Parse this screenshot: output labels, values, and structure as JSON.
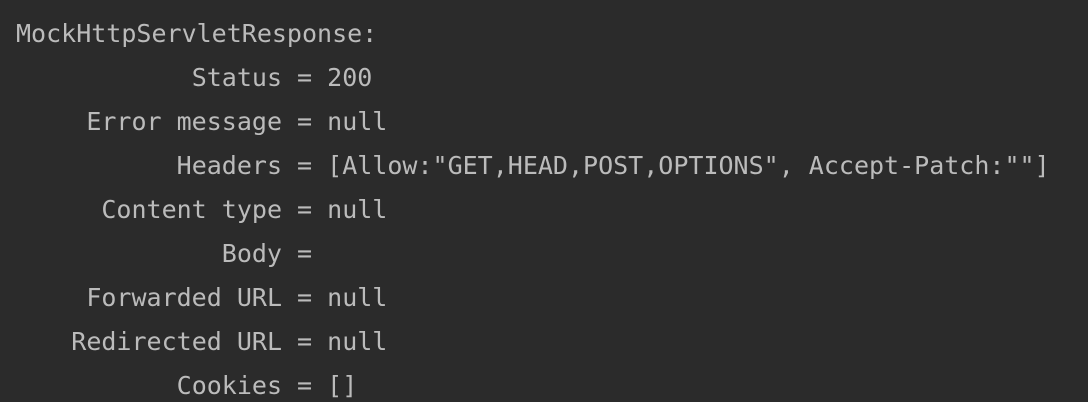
{
  "console": {
    "title": "MockHttpServletResponse:",
    "separator": " = ",
    "fields": [
      {
        "key": "Status",
        "value": "200"
      },
      {
        "key": "Error message",
        "value": "null"
      },
      {
        "key": "Headers",
        "value": "[Allow:\"GET,HEAD,POST,OPTIONS\", Accept-Patch:\"\"]"
      },
      {
        "key": "Content type",
        "value": "null"
      },
      {
        "key": "Body",
        "value": ""
      },
      {
        "key": "Forwarded URL",
        "value": "null"
      },
      {
        "key": "Redirected URL",
        "value": "null"
      },
      {
        "key": "Cookies",
        "value": "[]"
      }
    ]
  }
}
